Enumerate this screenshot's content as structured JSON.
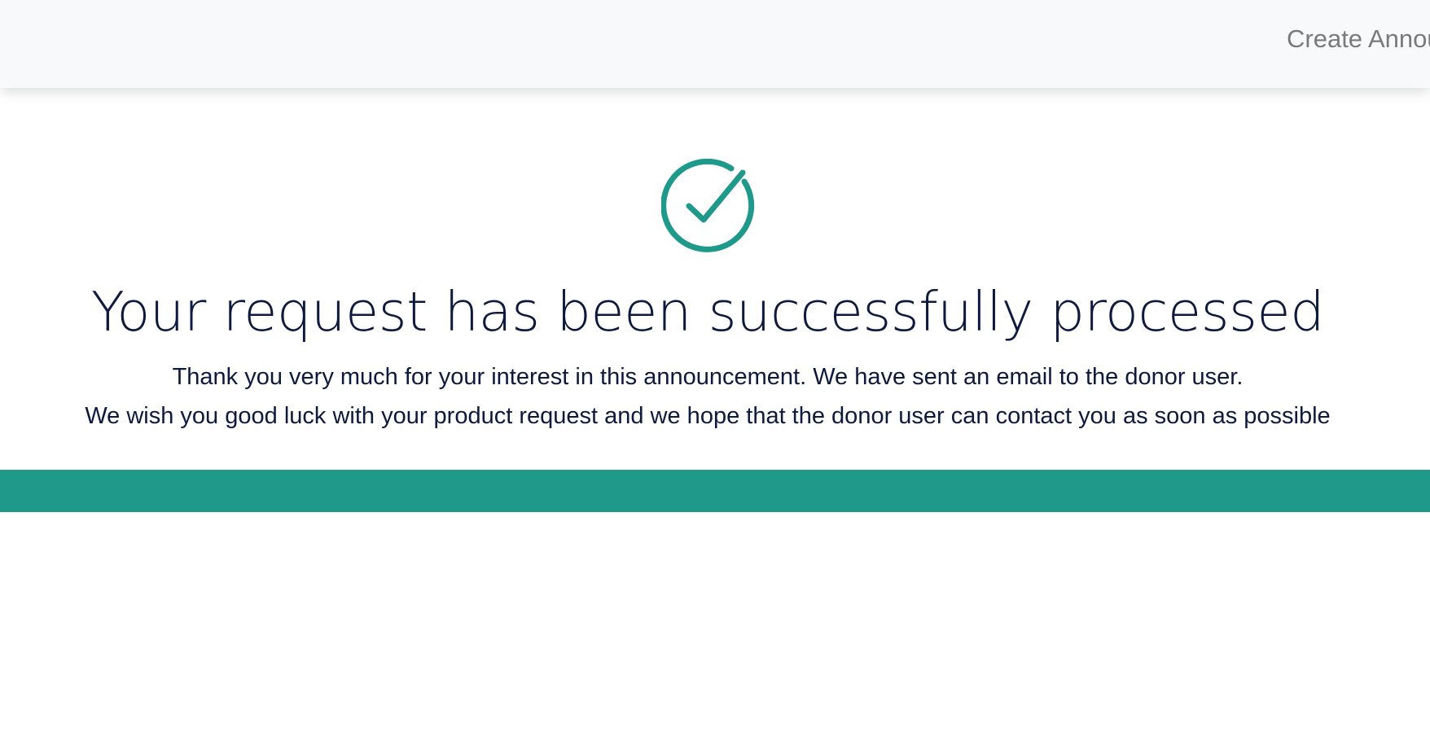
{
  "header": {
    "nav_link_label": "Create Announcement"
  },
  "main": {
    "icon": "check-circle-icon",
    "title": "Your request has been successfully processed",
    "message_line1": "Thank you very much for your interest in this announcement. We have sent an email to the donor user.",
    "message_line2": "We wish you good luck with your product request and we hope that the donor user can contact you as soon as possible"
  },
  "colors": {
    "accent": "#1f9a8a",
    "text": "#0e1a3d",
    "header_bg": "#f8f9fa",
    "nav_text": "#7a7a7a"
  }
}
